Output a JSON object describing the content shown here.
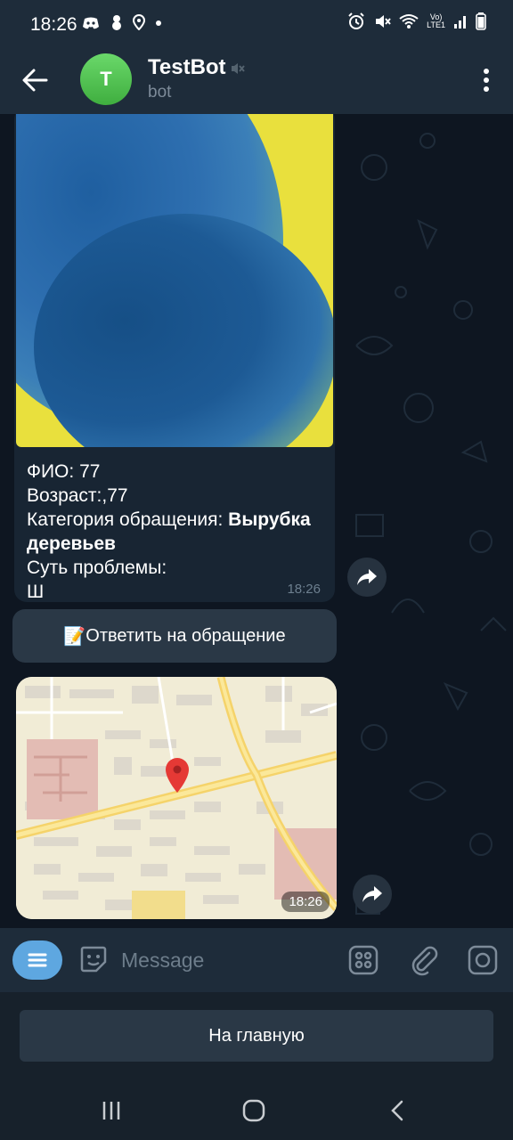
{
  "status_bar": {
    "time": "18:26",
    "left_icons": [
      "discord-icon",
      "snowman-icon",
      "location-icon",
      "dot-icon"
    ],
    "right_icons": [
      "alarm-icon",
      "mute-icon",
      "wifi-icon",
      "volte-icon",
      "signal-icon",
      "battery-icon"
    ],
    "volte_top": "Vo)",
    "volte_bottom": "LTE1"
  },
  "header": {
    "avatar_letter": "T",
    "title": "TestBot",
    "subtitle": "bot",
    "accent": "#5ea7e0",
    "avatar_color": "#4fbf4f"
  },
  "messages": {
    "photo_message": {
      "caption_fio_label": "ФИО: ",
      "caption_fio_value": "77",
      "caption_age": "Возраст:,77",
      "caption_category_label": "Категория обращения: ",
      "caption_category_value": "Вырубка деревьев",
      "caption_problem_label": "Суть проблемы:",
      "caption_problem_value": "Ш",
      "time": "18:26"
    },
    "inline_button": {
      "emoji": "📝",
      "label": "Ответить на обращение"
    },
    "map_message": {
      "time": "18:26"
    }
  },
  "input": {
    "placeholder": "Message"
  },
  "reply_keyboard": {
    "button_label": "На главную"
  },
  "nav_bar": {
    "icons": [
      "recents-icon",
      "home-icon",
      "back-nav-icon"
    ]
  }
}
